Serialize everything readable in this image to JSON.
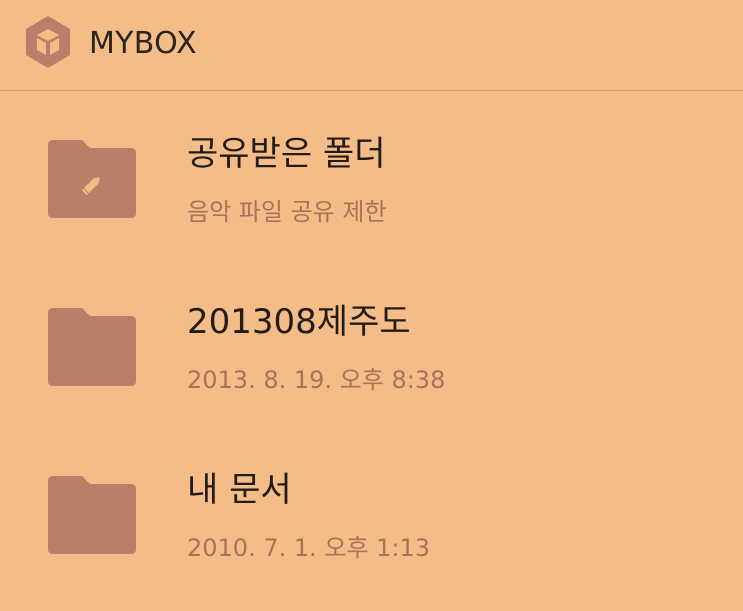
{
  "app": {
    "title": "MYBOX",
    "logo_icon": "cube-hexagon-icon"
  },
  "colors": {
    "background": "#f4bd88",
    "folder": "#b98069",
    "title_text": "#221c18",
    "subtitle_text": "#a8725a"
  },
  "folders": [
    {
      "name": "공유받은 폴더",
      "detail": "음악 파일 공유 제한",
      "icon": "shared-folder-pencil-icon"
    },
    {
      "name": "201308제주도",
      "detail": "2013. 8. 19. 오후 8:38",
      "icon": "folder-icon"
    },
    {
      "name": "내 문서",
      "detail": "2010. 7. 1. 오후 1:13",
      "icon": "folder-icon"
    }
  ]
}
